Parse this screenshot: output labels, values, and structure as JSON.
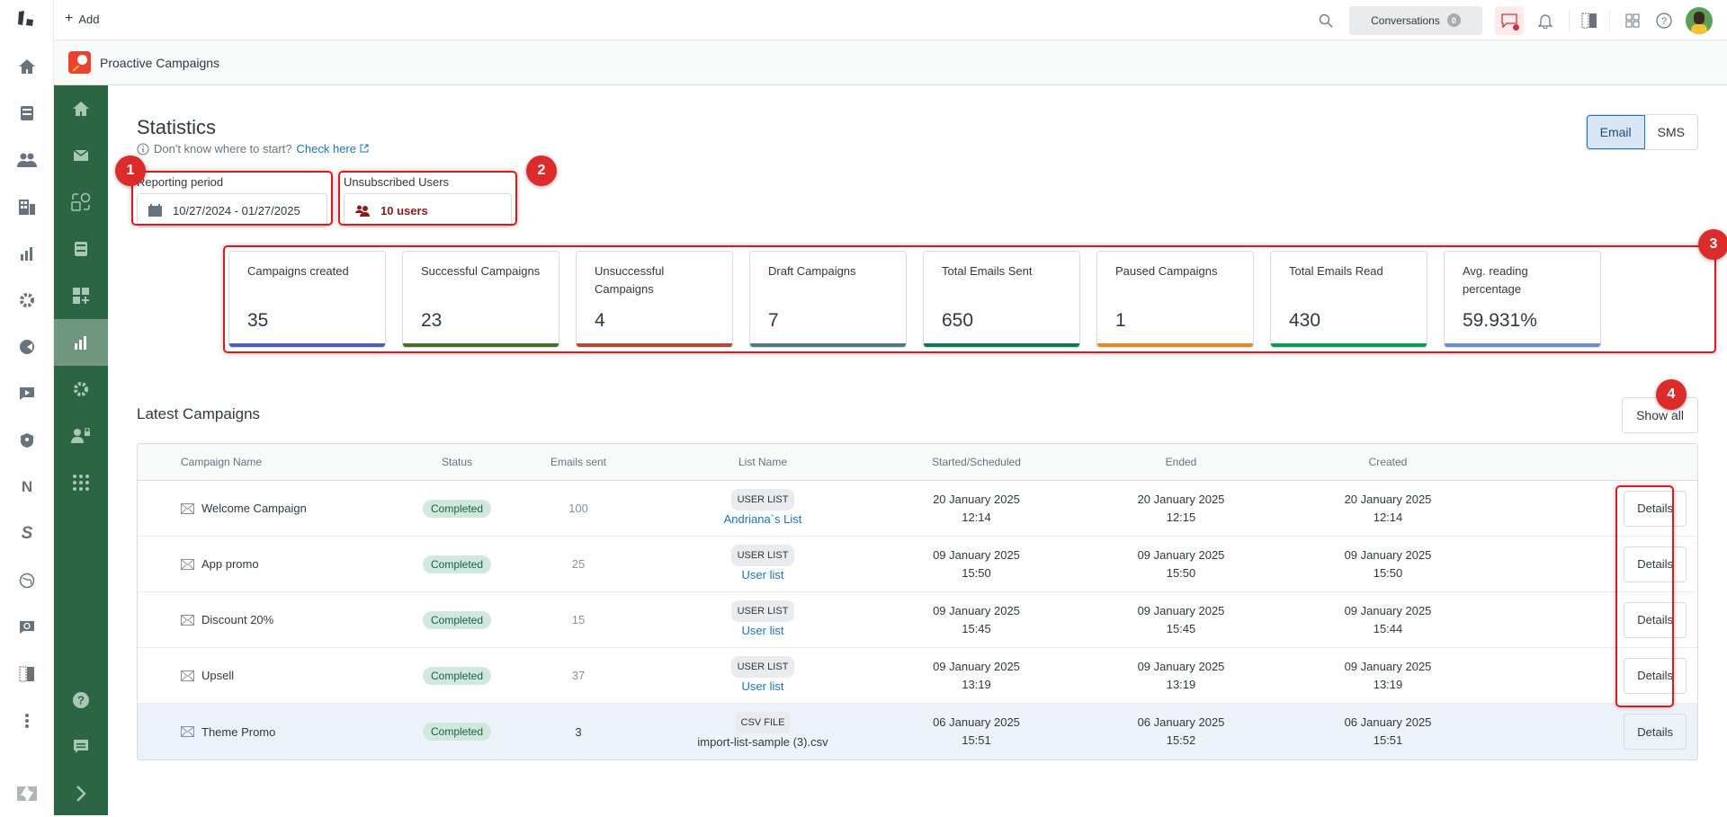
{
  "topbar": {
    "add_label": "Add",
    "conversations_label": "Conversations",
    "conversations_count": "0"
  },
  "app": {
    "title": "Proactive Campaigns"
  },
  "page": {
    "title": "Statistics",
    "help_text": "Don't know where to start?",
    "help_link": "Check here",
    "channel_tabs": [
      {
        "label": "Email",
        "active": true
      },
      {
        "label": "SMS",
        "active": false
      }
    ]
  },
  "filters": {
    "reporting_period_label": "Reporting period",
    "reporting_period_value": "10/27/2024 - 01/27/2025",
    "unsubscribed_label": "Unsubscribed Users",
    "unsubscribed_value": "10 users"
  },
  "annotations": [
    "1",
    "2",
    "3",
    "4"
  ],
  "stats": [
    {
      "title": "Campaigns created",
      "value": "35",
      "color": "#4a5fc1"
    },
    {
      "title": "Successful Campaigns",
      "value": "23",
      "color": "#4a6e2a"
    },
    {
      "title": "Unsuccessful Campaigns",
      "value": "4",
      "color": "#b04a3c"
    },
    {
      "title": "Draft Campaigns",
      "value": "7",
      "color": "#4a7d7e"
    },
    {
      "title": "Total Emails Sent",
      "value": "650",
      "color": "#0d7a4a"
    },
    {
      "title": "Paused Campaigns",
      "value": "1",
      "color": "#e08a2a"
    },
    {
      "title": "Total Emails Read",
      "value": "430",
      "color": "#0e9a55"
    },
    {
      "title": "Avg. reading percentage",
      "value": "59.931%",
      "color": "#6b8fcf"
    }
  ],
  "latest": {
    "title": "Latest Campaigns",
    "show_all": "Show all",
    "columns": [
      "Campaign Name",
      "Status",
      "Emails sent",
      "List Name",
      "Started/Scheduled",
      "Ended",
      "Created"
    ],
    "details_label": "Details",
    "rows": [
      {
        "name": "Welcome Campaign",
        "status": "Completed",
        "sent": "100",
        "list_type": "USER LIST",
        "list_name": "Andriana`s List",
        "list_link": true,
        "started_date": "20 January 2025",
        "started_time": "12:14",
        "ended_date": "20 January 2025",
        "ended_time": "12:15",
        "created_date": "20 January 2025",
        "created_time": "12:14"
      },
      {
        "name": "App promo",
        "status": "Completed",
        "sent": "25",
        "list_type": "USER LIST",
        "list_name": "User list",
        "list_link": true,
        "started_date": "09 January 2025",
        "started_time": "15:50",
        "ended_date": "09 January 2025",
        "ended_time": "15:50",
        "created_date": "09 January 2025",
        "created_time": "15:50"
      },
      {
        "name": "Discount 20%",
        "status": "Completed",
        "sent": "15",
        "list_type": "USER LIST",
        "list_name": "User list",
        "list_link": true,
        "started_date": "09 January 2025",
        "started_time": "15:45",
        "ended_date": "09 January 2025",
        "ended_time": "15:45",
        "created_date": "09 January 2025",
        "created_time": "15:44"
      },
      {
        "name": "Upsell",
        "status": "Completed",
        "sent": "37",
        "list_type": "USER LIST",
        "list_name": "User list",
        "list_link": true,
        "started_date": "09 January 2025",
        "started_time": "13:19",
        "ended_date": "09 January 2025",
        "ended_time": "13:19",
        "created_date": "09 January 2025",
        "created_time": "13:19"
      },
      {
        "name": "Theme Promo",
        "status": "Completed",
        "sent": "3",
        "list_type": "CSV FILE",
        "list_name": "import-list-sample (3).csv",
        "list_link": false,
        "started_date": "06 January 2025",
        "started_time": "15:51",
        "ended_date": "06 January 2025",
        "ended_time": "15:52",
        "created_date": "06 January 2025",
        "created_time": "15:51"
      }
    ]
  }
}
